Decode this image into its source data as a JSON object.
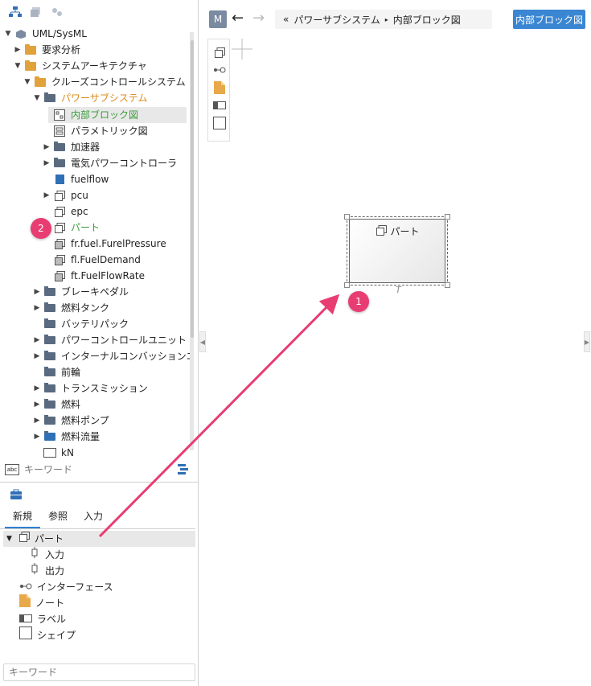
{
  "tree": {
    "root": "UML/SysML",
    "items": [
      {
        "label": "要求分析"
      },
      {
        "label": "システムアーキテクチャ"
      },
      {
        "label": "クルーズコントロールシステム"
      },
      {
        "label": "パワーサブシステム"
      },
      {
        "label": "内部ブロック図"
      },
      {
        "label": "パラメトリック図"
      },
      {
        "label": "加速器"
      },
      {
        "label": "電気パワーコントローラ"
      },
      {
        "label": "fuelflow"
      },
      {
        "label": "pcu"
      },
      {
        "label": "epc"
      },
      {
        "label": "パート"
      },
      {
        "label": "fr.fuel.FurelPressure"
      },
      {
        "label": "fl.FuelDemand"
      },
      {
        "label": "ft.FuelFlowRate"
      },
      {
        "label": "ブレーキペダル"
      },
      {
        "label": "燃料タンク"
      },
      {
        "label": "バッテリパック"
      },
      {
        "label": "パワーコントロールユニット"
      },
      {
        "label": "インターナルコンバッションエンジン"
      },
      {
        "label": "前輪"
      },
      {
        "label": "トランスミッション"
      },
      {
        "label": "燃料"
      },
      {
        "label": "燃料ポンプ"
      },
      {
        "label": "燃料流量"
      },
      {
        "label": "kN"
      }
    ],
    "search_placeholder": "キーワード",
    "search_icon_text": "abc"
  },
  "palette": {
    "tabs": [
      {
        "label": "新規"
      },
      {
        "label": "参照"
      },
      {
        "label": "入力"
      }
    ],
    "items": [
      {
        "label": "パート"
      },
      {
        "label": "入力"
      },
      {
        "label": "出力"
      },
      {
        "label": "インターフェース"
      },
      {
        "label": "ノート"
      },
      {
        "label": "ラベル"
      },
      {
        "label": "シェイプ"
      }
    ],
    "search_placeholder": "キーワード"
  },
  "header": {
    "m_button": "M",
    "back": "←",
    "forward": "→",
    "breadcrumb_prefix": "«",
    "breadcrumb_parent": "パワーサブシステム",
    "breadcrumb_sep": "▸",
    "breadcrumb_current": "内部ブロック図",
    "action_button": "内部ブロック図"
  },
  "canvas": {
    "part_label": "パート",
    "part_caption": "T"
  },
  "badges": {
    "one": "1",
    "two": "2"
  },
  "colors": {
    "accent": "#3a86d3",
    "badge": "#e83d72",
    "selected_text": "#d98a1b",
    "part_text": "#3a9b3a"
  }
}
